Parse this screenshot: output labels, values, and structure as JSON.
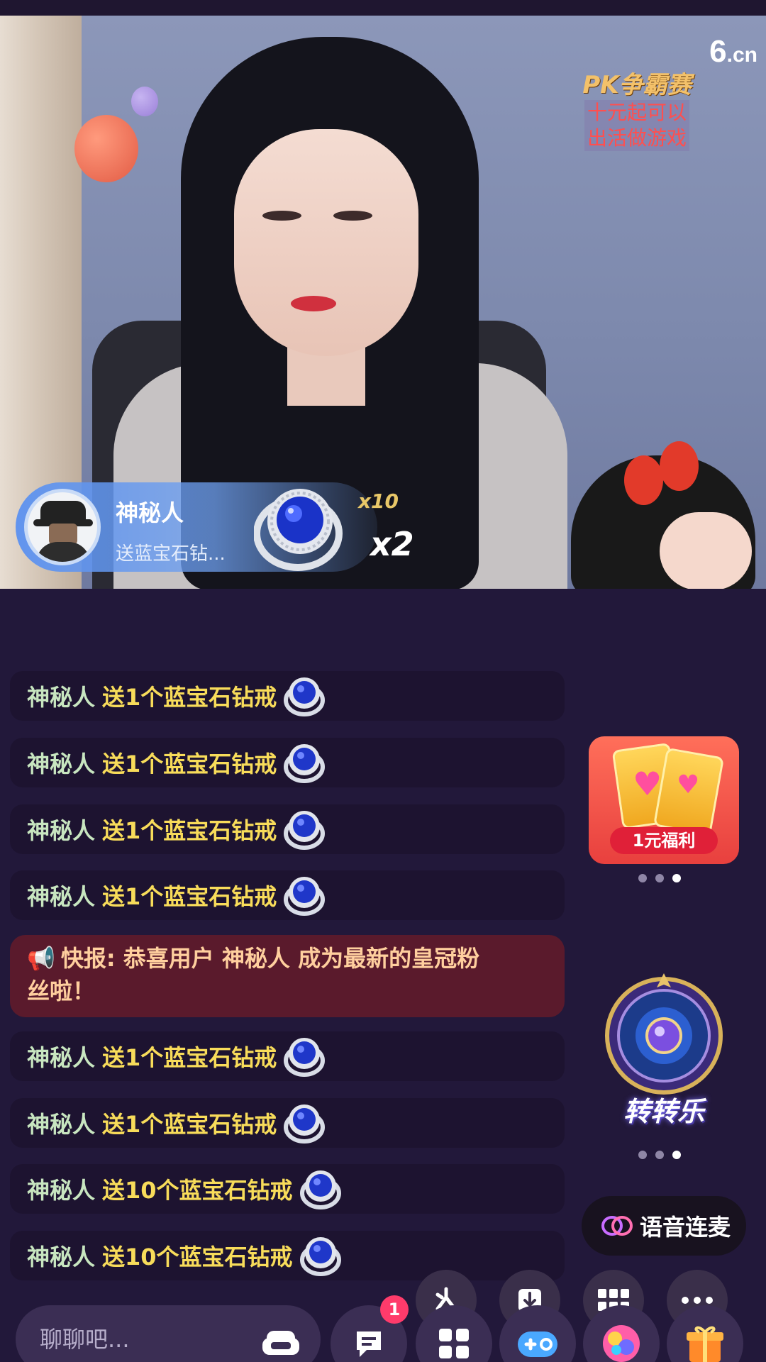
{
  "stream": {
    "logo": "6",
    "logo_suffix": ".cn",
    "promo_overlay": {
      "title": "PK争霸赛",
      "line1": "十元起可以",
      "line2": "出活做游戏"
    }
  },
  "gift_banner": {
    "user": "神秘人",
    "description": "送蓝宝石钻...",
    "multiplier_small": "x10",
    "multiplier_big": "x2"
  },
  "chat": {
    "messages": [
      {
        "name": "神秘人",
        "text": "送1个蓝宝石钻戒"
      },
      {
        "name": "神秘人",
        "text": "送1个蓝宝石钻戒"
      },
      {
        "name": "神秘人",
        "text": "送1个蓝宝石钻戒"
      },
      {
        "name": "神秘人",
        "text": "送1个蓝宝石钻戒"
      },
      {
        "name": "神秘人",
        "text": "送1个蓝宝石钻戒"
      },
      {
        "name": "神秘人",
        "text": "送1个蓝宝石钻戒"
      },
      {
        "name": "神秘人",
        "text": "送10个蓝宝石钻戒"
      },
      {
        "name": "神秘人",
        "text": "送10个蓝宝石钻戒"
      }
    ],
    "announcement": {
      "icon": "📢",
      "line1": "快报: 恭喜用户 神秘人 成为最新的皇冠粉",
      "line2": "丝啦！"
    }
  },
  "side": {
    "promo_label": "1元福利",
    "wheel_label": "转转乐",
    "voice_label": "语音连麦"
  },
  "bottom": {
    "input_placeholder": "聊聊吧...",
    "badge_count": "1"
  },
  "colors": {
    "background": "#22183a",
    "chat_name": "#c8e6c0",
    "chat_text": "#f8dc5a",
    "announce_bg": "#5a1a2c"
  }
}
